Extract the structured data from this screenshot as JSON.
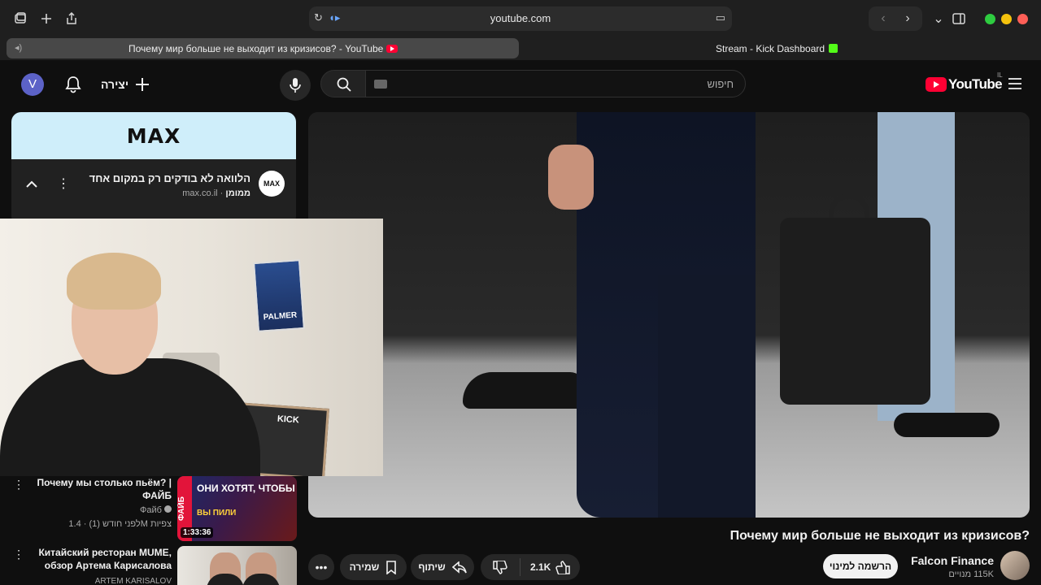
{
  "browser": {
    "url": "youtube.com",
    "tabs": [
      {
        "title": "Почему мир больше не выходит из кризисов? - YouTube",
        "active": true
      },
      {
        "title": "Stream - Kick Dashboard",
        "active": false
      }
    ]
  },
  "header": {
    "avatar_letter": "V",
    "create_label": "יצירה",
    "search_placeholder": "חיפוש",
    "logo_text": "YouTube",
    "country_code": "IL"
  },
  "ad": {
    "banner_logo": "MAX",
    "logo_small": "MAX",
    "title": "הלוואה לא בודקים רק במקום אחד",
    "sponsored": "ממומן",
    "domain": "max.co.il"
  },
  "video": {
    "title": "Почему мир больше не выходит из кризисов?",
    "channel_name": "Falcon Finance",
    "subscribers": "115K מנויים",
    "subscribe_label": "הרשמה למינוי",
    "likes": "2.1K",
    "share_label": "שיתוף",
    "save_label": "שמירה"
  },
  "webcam": {
    "poster_text": "PALMER",
    "sticker_text": "KICK"
  },
  "suggestions": [
    {
      "title": "Почему мы столько пьём? | ФАЙБ",
      "channel": "Файб",
      "views": "1.4M צפיות",
      "age": "לפני חודש (1)",
      "duration": "1:33:36",
      "thumb_text": "ОНИ ХОТЯТ, ЧТОБЫ",
      "thumb_text2": "ВЫ ПИЛИ",
      "thumb_side": "ФАЙБ"
    },
    {
      "title": "Китайский ресторан MUME, обзор Артема Карисалова",
      "channel": "ARTEM KARISALOV"
    }
  ]
}
